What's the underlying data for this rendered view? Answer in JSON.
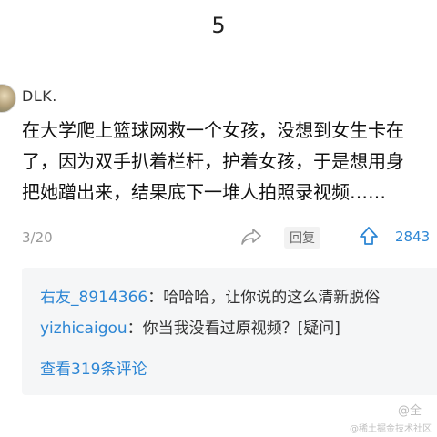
{
  "page_number": "5",
  "comment": {
    "username": "DLK.",
    "text_lines": [
      "在大学爬上篮球网救一个女孩，没想到女生卡在",
      "了，因为双手扒着栏杆，护着女孩，于是想用身",
      "把她蹭出来，结果底下一堆人拍照录视频……"
    ],
    "date": "3/20",
    "reply_label": "回复",
    "up_count": "2843"
  },
  "replies": [
    {
      "name": "右友_8914366",
      "text": "：哈哈哈，让你说的这么清新脱俗"
    },
    {
      "name": "yizhicaigou",
      "text": "：你当我没看过原视频？[疑问]"
    }
  ],
  "view_more": "查看319条评论",
  "watermarks": {
    "weibo": "@全",
    "juejin": "@稀土掘金技术社区"
  },
  "colors": {
    "link_blue": "#2d86d4",
    "reply_bg": "#f5f6f7"
  }
}
